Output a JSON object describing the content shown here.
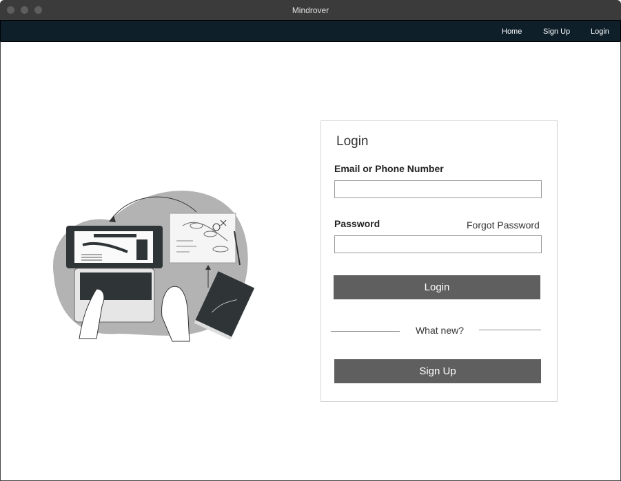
{
  "window": {
    "title": "Mindrover"
  },
  "nav": {
    "links": [
      "Home",
      "Sign Up",
      "Login"
    ]
  },
  "illustration": {
    "name": "person-using-laptop-illustration"
  },
  "login": {
    "title": "Login",
    "email_label": "Email or Phone Number",
    "email_value": "",
    "password_label": "Password",
    "password_value": "",
    "forgot_label": "Forgot Password",
    "login_button": "Login",
    "divider_text": "What new?",
    "signup_button": "Sign Up"
  },
  "colors": {
    "navbar": "#0f1f2a",
    "button": "#5f5f5f",
    "titlebar": "#3b3b3b"
  }
}
